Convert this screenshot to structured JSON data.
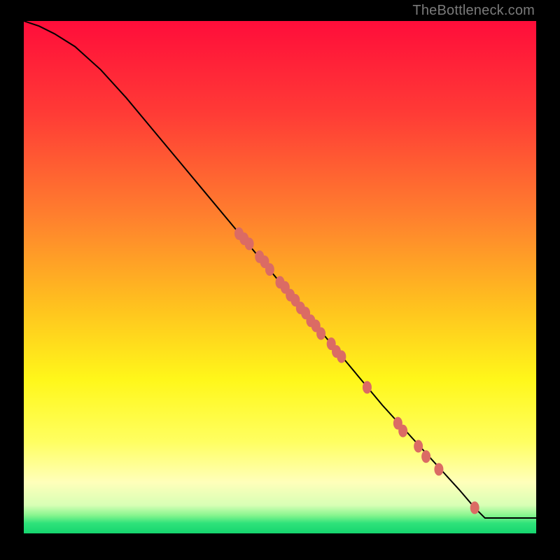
{
  "watermark": "TheBottleneck.com",
  "chart_data": {
    "type": "line",
    "title": "",
    "xlabel": "",
    "ylabel": "",
    "xlim": [
      0,
      100
    ],
    "ylim": [
      0,
      100
    ],
    "grid": false,
    "legend": false,
    "series": [
      {
        "name": "curve",
        "x": [
          0,
          3,
          6,
          10,
          15,
          20,
          25,
          30,
          35,
          40,
          45,
          50,
          55,
          60,
          65,
          70,
          75,
          80,
          85,
          88,
          90,
          95,
          100
        ],
        "y": [
          100,
          99,
          97.5,
          95,
          90.5,
          85,
          79,
          73,
          67,
          61,
          55,
          49,
          43,
          37,
          31,
          25,
          19.5,
          14,
          8.5,
          5,
          3,
          3,
          3
        ]
      }
    ],
    "markers": [
      {
        "x": 42,
        "y": 58.5
      },
      {
        "x": 43,
        "y": 57.5
      },
      {
        "x": 44,
        "y": 56.5
      },
      {
        "x": 46,
        "y": 54
      },
      {
        "x": 47,
        "y": 53
      },
      {
        "x": 48,
        "y": 51.5
      },
      {
        "x": 50,
        "y": 49
      },
      {
        "x": 51,
        "y": 48
      },
      {
        "x": 52,
        "y": 46.5
      },
      {
        "x": 53,
        "y": 45.5
      },
      {
        "x": 54,
        "y": 44
      },
      {
        "x": 55,
        "y": 43
      },
      {
        "x": 56,
        "y": 41.5
      },
      {
        "x": 57,
        "y": 40.5
      },
      {
        "x": 58,
        "y": 39
      },
      {
        "x": 60,
        "y": 37
      },
      {
        "x": 61,
        "y": 35.5
      },
      {
        "x": 62,
        "y": 34.5
      },
      {
        "x": 67,
        "y": 28.5
      },
      {
        "x": 73,
        "y": 21.5
      },
      {
        "x": 74,
        "y": 20
      },
      {
        "x": 77,
        "y": 17
      },
      {
        "x": 78.5,
        "y": 15
      },
      {
        "x": 81,
        "y": 12.5
      },
      {
        "x": 88,
        "y": 5
      }
    ],
    "gradient_stops": [
      {
        "offset": 0,
        "color": "#ff0d3a"
      },
      {
        "offset": 0.18,
        "color": "#ff3b36"
      },
      {
        "offset": 0.38,
        "color": "#ff7f2e"
      },
      {
        "offset": 0.55,
        "color": "#ffbf1f"
      },
      {
        "offset": 0.7,
        "color": "#fff71a"
      },
      {
        "offset": 0.82,
        "color": "#ffff60"
      },
      {
        "offset": 0.9,
        "color": "#ffffba"
      },
      {
        "offset": 0.945,
        "color": "#d8ffb5"
      },
      {
        "offset": 0.965,
        "color": "#86f58e"
      },
      {
        "offset": 0.98,
        "color": "#2fe27a"
      },
      {
        "offset": 1.0,
        "color": "#16d66f"
      }
    ],
    "marker_color": "#db6b64",
    "curve_color": "#000000"
  }
}
